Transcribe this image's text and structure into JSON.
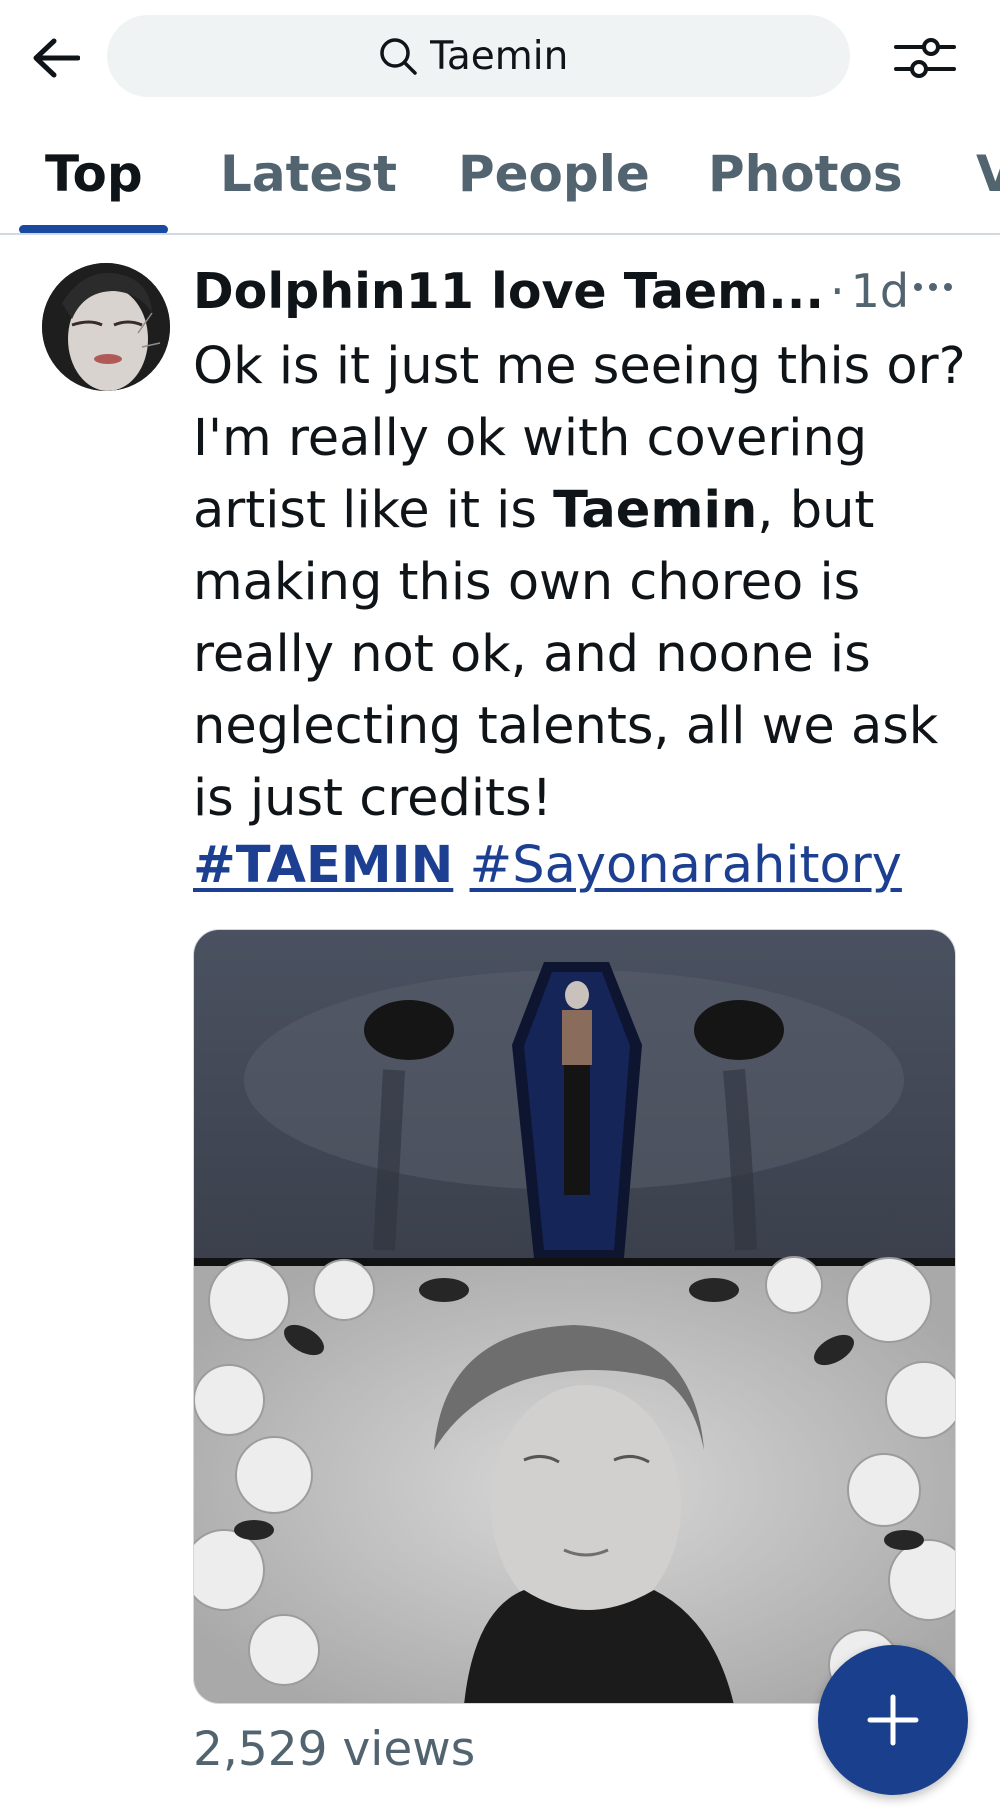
{
  "header": {
    "back_icon": "arrow-left-icon",
    "search_icon": "search-icon",
    "search_value": "Taemin",
    "filter_icon": "sliders-icon"
  },
  "tabs": [
    {
      "label": "Top",
      "active": true
    },
    {
      "label": "Latest",
      "active": false
    },
    {
      "label": "People",
      "active": false
    },
    {
      "label": "Photos",
      "active": false
    },
    {
      "label": "V",
      "active": false
    }
  ],
  "post": {
    "author": "Dolphin11 love Taem...",
    "separator": "·",
    "time": "1d",
    "more_label": "···",
    "text_part1": "Ok is it just me seeing this or? I'm really ok with covering artist like it is ",
    "text_bold": "Taemin",
    "text_part2": ", but making this own choreo is really not ok, and noone is neglecting talents, all we ask is just credits!",
    "hashtags": [
      "#TAEMIN",
      "#Sayonarahitory"
    ],
    "views": "2,529 views"
  },
  "fab": {
    "icon": "plus-icon"
  },
  "colors": {
    "accent": "#1a4aa0",
    "hashtag": "#1d3f91",
    "fab": "#1a3f8c",
    "secondary_text": "#536471",
    "search_bg": "#eff3f4"
  }
}
